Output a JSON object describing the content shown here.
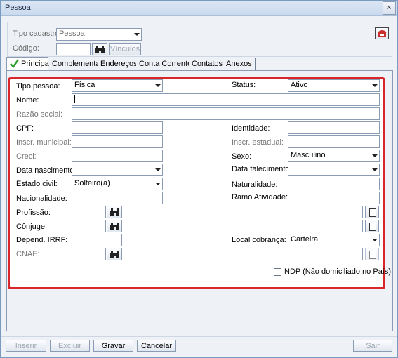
{
  "window": {
    "title": "Pessoa",
    "close_icon": "×"
  },
  "top": {
    "tipo_cadastro_label": "Tipo cadastro",
    "tipo_cadastro_value": "Pessoa",
    "codigo_label": "Código:",
    "vinculos_label": "Vínculos"
  },
  "tabs": [
    {
      "label": "Principal"
    },
    {
      "label": "Complementar"
    },
    {
      "label": "Endereços"
    },
    {
      "label": "Conta Corrente"
    },
    {
      "label": "Contatos"
    },
    {
      "label": "Anexos"
    }
  ],
  "form": {
    "tipo_pessoa_label": "Tipo pessoa:",
    "tipo_pessoa_value": "Física",
    "status_label": "Status:",
    "status_value": "Ativo",
    "nome_label": "Nome:",
    "razao_social_label": "Razão social:",
    "cpf_label": "CPF:",
    "identidade_label": "Identidade:",
    "inscr_municipal_label": "Inscr. municipal:",
    "inscr_estadual_label": "Inscr. estadual:",
    "creci_label": "Creci:",
    "sexo_label": "Sexo:",
    "sexo_value": "Masculino",
    "data_nascimento_label": "Data nascimento:",
    "data_falecimento_label": "Data falecimento:",
    "estado_civil_label": "Estado civil:",
    "estado_civil_value": "Solteiro(a)",
    "naturalidade_label": "Naturalidade:",
    "nacionalidade_label": "Nacionalidade:",
    "ramo_atividade_label": "Ramo Atividade:",
    "profissao_label": "Profissão:",
    "conjuge_label": "Cônjuge:",
    "depend_irrf_label": "Depend. IRRF:",
    "local_cobranca_label": "Local cobrança:",
    "local_cobranca_value": "Carteira",
    "cnae_label": "CNAE:",
    "ndp_label": "NDP (Não domiciliado no País)"
  },
  "buttons": {
    "inserir": "Inserir",
    "excluir": "Excluir",
    "gravar": "Gravar",
    "cancelar": "Cancelar",
    "sair": "Sair"
  },
  "colors": {
    "highlight_border": "#d9262b",
    "check": "#2e9e2e"
  }
}
